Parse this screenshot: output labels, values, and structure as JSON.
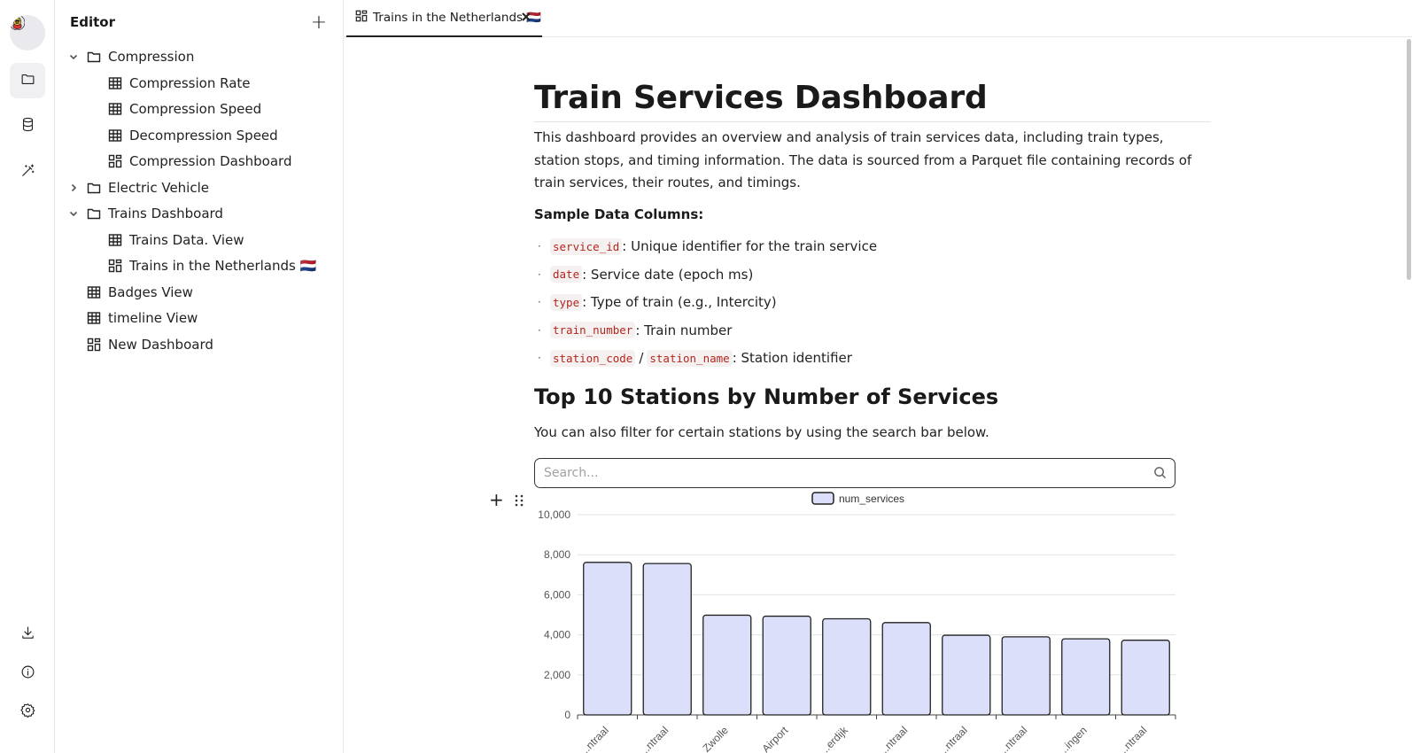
{
  "rail": {
    "items": [
      {
        "name": "explorer",
        "active": true
      },
      {
        "name": "database",
        "active": false
      },
      {
        "name": "magic-wand",
        "active": false
      }
    ],
    "bottom": [
      "download",
      "info",
      "settings"
    ]
  },
  "sidebar": {
    "title": "Editor",
    "add_label": "+",
    "items": [
      {
        "label": "Compression",
        "kind": "folder",
        "level": 0,
        "expanded": true
      },
      {
        "label": "Compression Rate",
        "kind": "table",
        "level": 1
      },
      {
        "label": "Compression Speed",
        "kind": "table",
        "level": 1
      },
      {
        "label": "Decompression Speed",
        "kind": "table",
        "level": 1
      },
      {
        "label": "Compression Dashboard",
        "kind": "dashboard",
        "level": 1
      },
      {
        "label": "Electric Vehicle",
        "kind": "folder",
        "level": 0,
        "expanded": false
      },
      {
        "label": "Trains Dashboard",
        "kind": "folder",
        "level": 0,
        "expanded": true
      },
      {
        "label": "Trains Data. View",
        "kind": "table",
        "level": 1
      },
      {
        "label": "Trains in the Netherlands 🇳🇱",
        "kind": "dashboard",
        "level": 1
      },
      {
        "label": "Badges View",
        "kind": "table",
        "level": 0
      },
      {
        "label": "timeline View",
        "kind": "table",
        "level": 0
      },
      {
        "label": "New Dashboard",
        "kind": "dashboard",
        "level": 0
      }
    ]
  },
  "tab": {
    "label": "Trains in the Netherlands 🇳🇱"
  },
  "main": {
    "title": "Train Services Dashboard",
    "description": "This dashboard provides an overview and analysis of train services data, including train types, station stops, and timing information. The data is sourced from a Parquet file containing records of train services, their routes, and timings.",
    "sample_heading": "Sample Data Columns:",
    "columns": [
      {
        "codes": [
          "service_id"
        ],
        "text": ": Unique identifier for the train service"
      },
      {
        "codes": [
          "date"
        ],
        "text": ": Service date (epoch ms)"
      },
      {
        "codes": [
          "type"
        ],
        "text": ": Type of train (e.g., Intercity)"
      },
      {
        "codes": [
          "train_number"
        ],
        "text": ": Train number"
      },
      {
        "codes": [
          "station_code",
          "station_name"
        ],
        "separator": "/",
        "text": ": Station identifier"
      }
    ],
    "section_title": "Top 10 Stations by Number of Services",
    "filter_note": "You can also filter for certain stations by using the search bar below.",
    "search": {
      "placeholder": "Search...",
      "value": ""
    }
  },
  "chart_data": {
    "type": "bar",
    "series": [
      {
        "name": "num_services",
        "values": [
          7620,
          7560,
          4980,
          4930,
          4800,
          4610,
          3980,
          3900,
          3800,
          3730
        ]
      }
    ],
    "categories": [
      "...ntraal",
      "...ntraal",
      "Zwolle",
      "...Airport",
      "...erdijk",
      "...ntraal",
      "...ntraal",
      "...ntraal",
      "...ingen",
      "...ntraal"
    ],
    "ylim": [
      0,
      10000
    ],
    "yticks": [
      "0",
      "2,000",
      "4,000",
      "6,000",
      "8,000",
      "10,000"
    ],
    "ytick_values": [
      0,
      2000,
      4000,
      6000,
      8000,
      10000
    ],
    "legend_position": "top-center",
    "bar_color": "#dcdffa",
    "bar_stroke": "#222222",
    "grid": true
  }
}
